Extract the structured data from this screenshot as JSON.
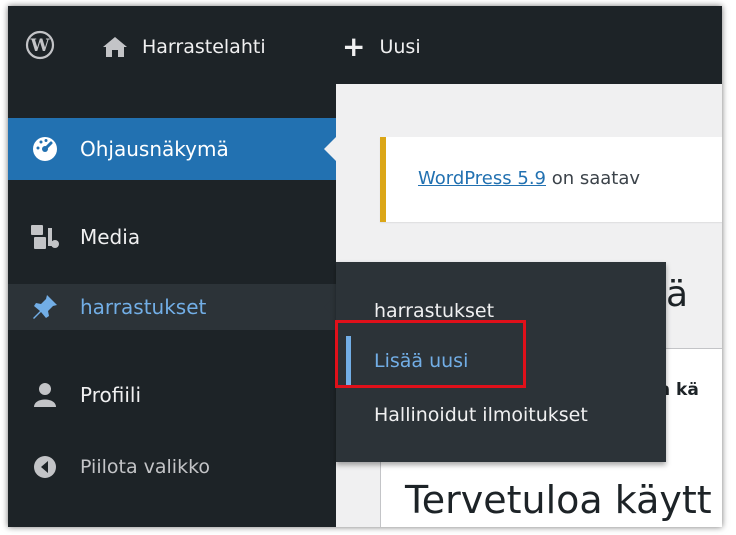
{
  "colors": {
    "admin_bg": "#1d2327",
    "submenu_bg": "#2c3338",
    "accent_blue": "#2271b1",
    "link_blue": "#72aee6",
    "notice_warning": "#dba617",
    "highlight_red": "#e0101a"
  },
  "adminbar": {
    "logo_icon": "wordpress-logo-icon",
    "site_icon": "home-icon",
    "site_name": "Harrastelahti",
    "new_icon": "plus-icon",
    "new_label": "Uusi"
  },
  "sidebar": {
    "dashboard": {
      "icon": "dashboard-gauge-icon",
      "label": "Ohjausnäkymä"
    },
    "media": {
      "icon": "media-icon",
      "label": "Media"
    },
    "harrastukset": {
      "icon": "pin-icon",
      "label": "harrastukset"
    },
    "profile": {
      "icon": "user-icon",
      "label": "Profiili"
    },
    "collapse": {
      "icon": "collapse-arrow-icon",
      "label": "Piilota valikko"
    }
  },
  "flyout": {
    "items": [
      {
        "label": "harrastukset"
      },
      {
        "label": "Lisää uusi",
        "current": true
      },
      {
        "label": "Hallinoidut ilmoitukset"
      }
    ]
  },
  "content": {
    "notice_link": "WordPress 5.9",
    "notice_text": " on saatav",
    "heading_fragment": "ä",
    "tab_fragment": "n kä",
    "welcome_title": "Tervetuloa käytt"
  }
}
